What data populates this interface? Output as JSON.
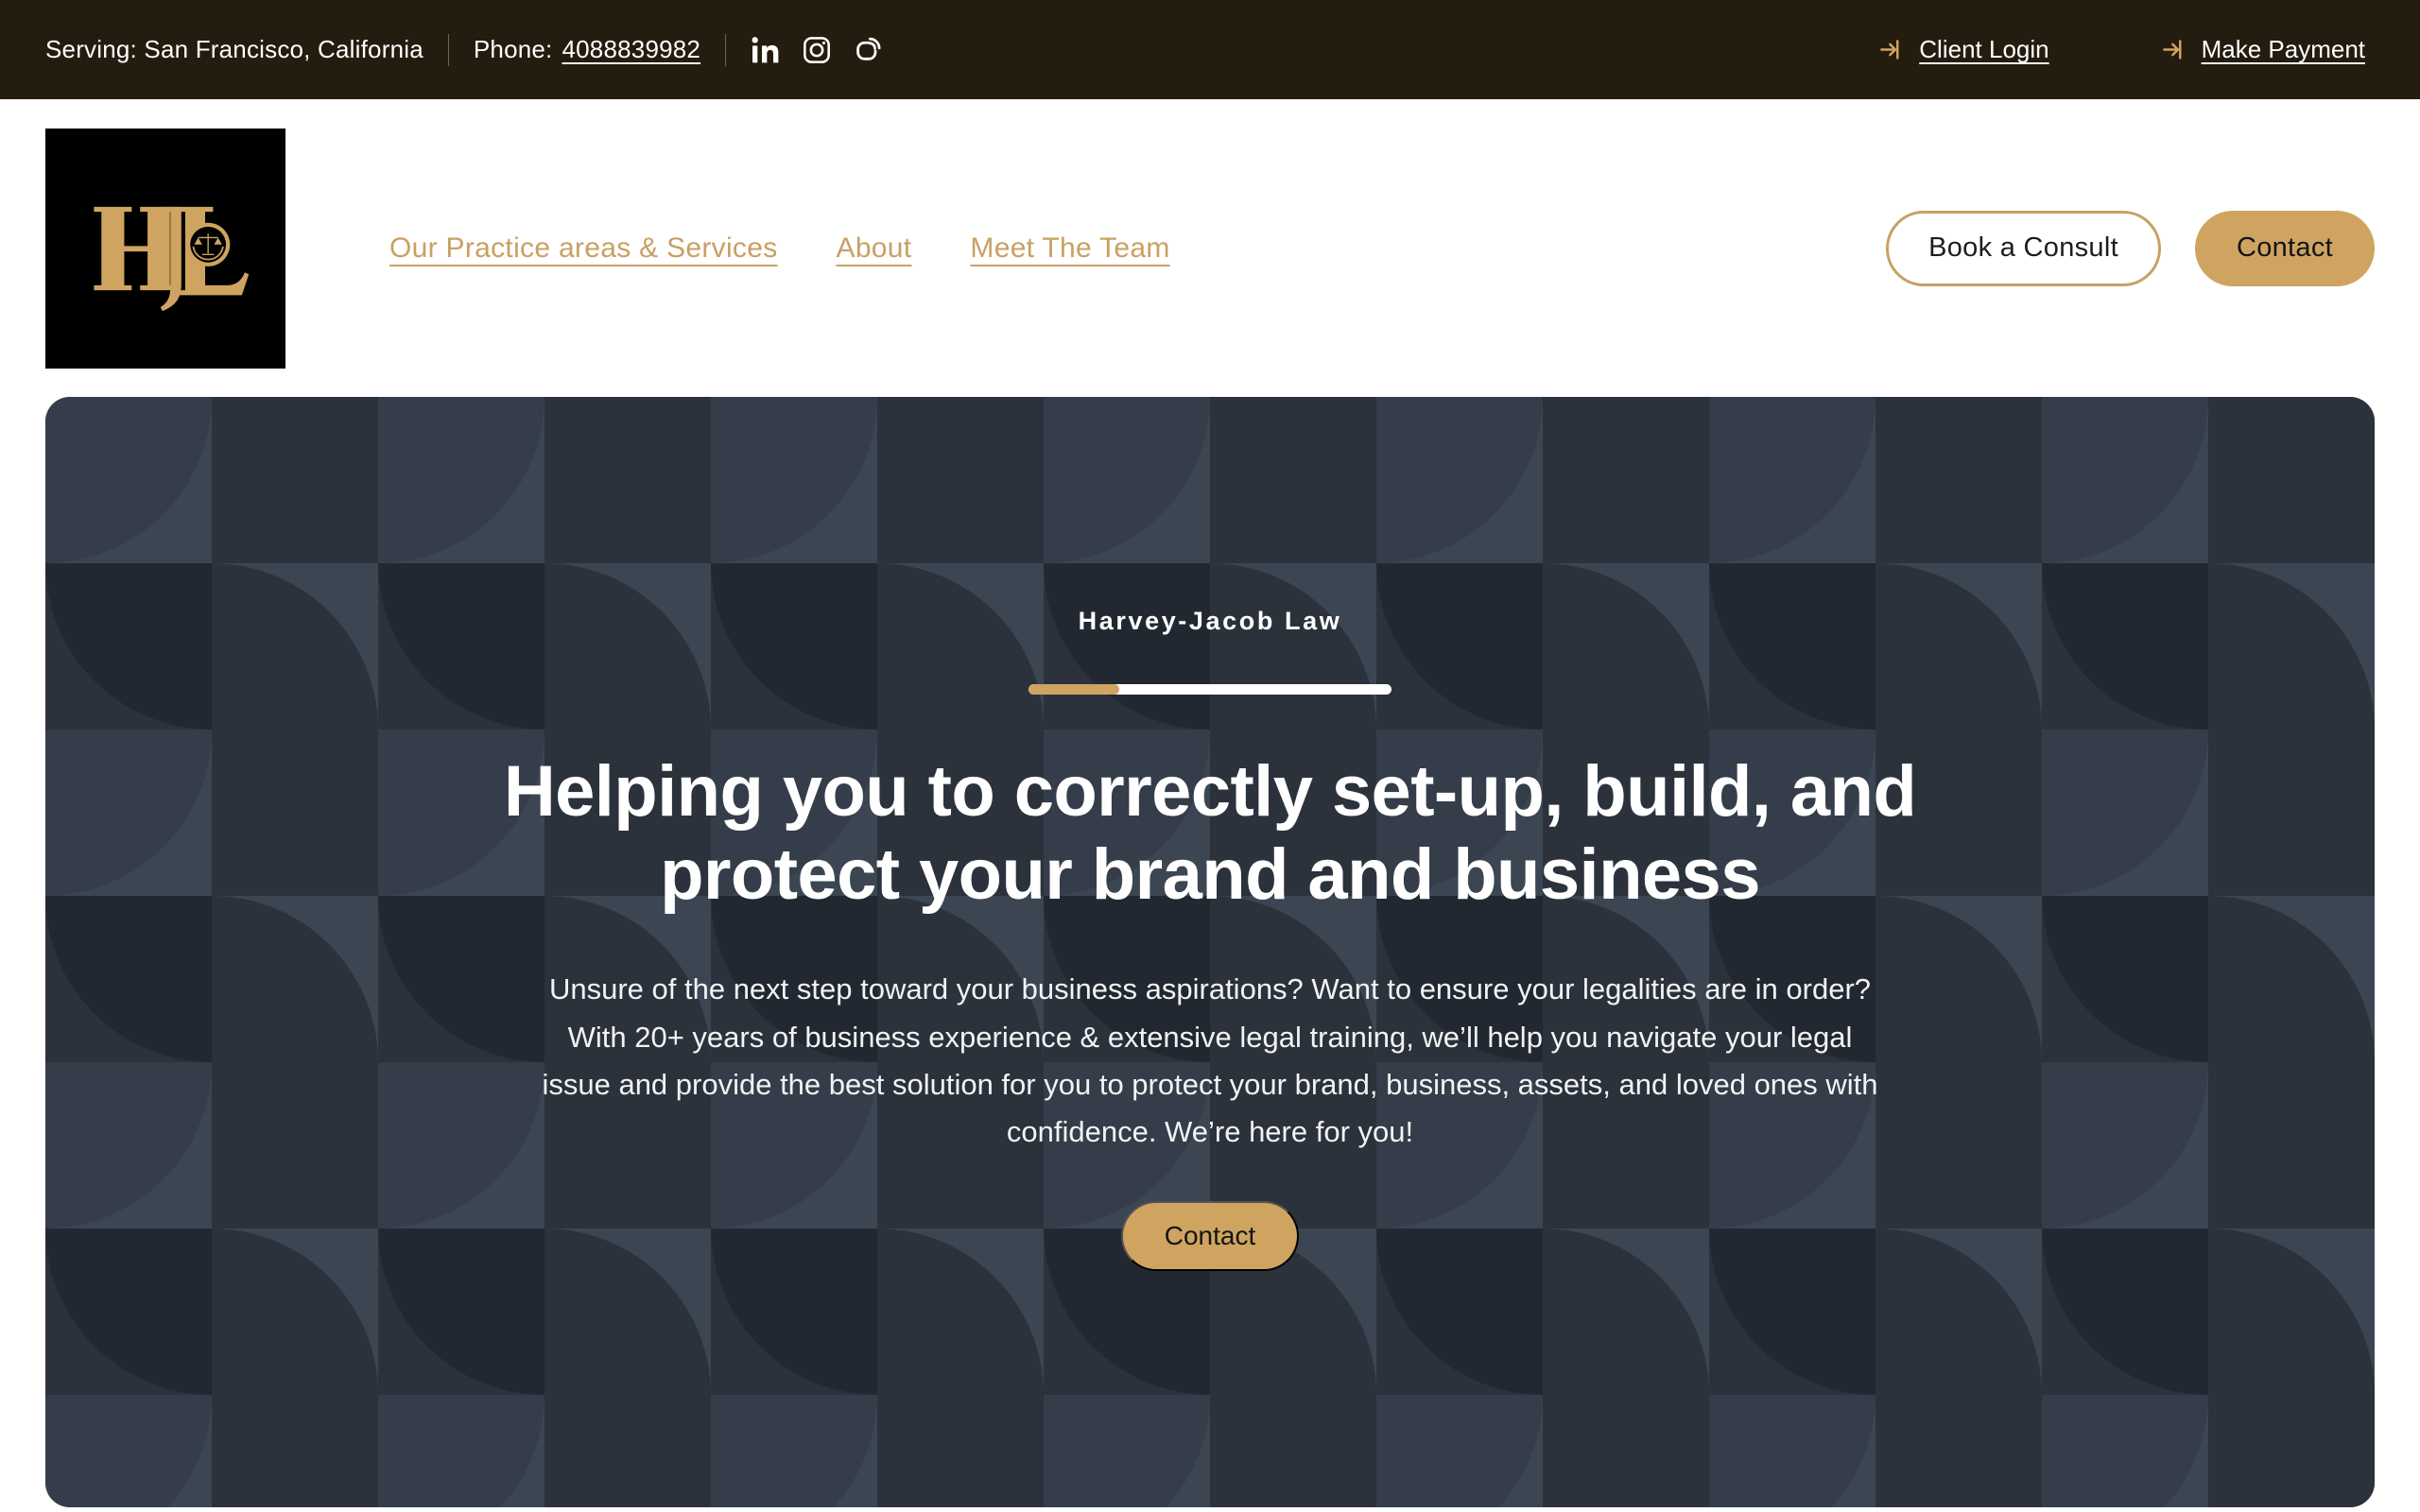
{
  "topbar": {
    "serving": "Serving: San Francisco, California",
    "phone_label": "Phone:",
    "phone_number": "4088839982",
    "socials": [
      {
        "name": "linkedin-icon"
      },
      {
        "name": "instagram-icon"
      },
      {
        "name": "blogger-icon"
      }
    ],
    "client_login": "Client Login",
    "make_payment": "Make Payment",
    "bg_color": "#241C0E"
  },
  "header": {
    "logo_alt": "HJL",
    "nav": [
      {
        "label": "Our Practice areas & Services"
      },
      {
        "label": "About"
      },
      {
        "label": "Meet The Team"
      }
    ],
    "book_consult": "Book a Consult",
    "contact": "Contact",
    "accent_color": "#CFA461"
  },
  "hero": {
    "eyebrow": "Harvey-Jacob Law",
    "progress_percent": 25,
    "title": "Helping you to correctly set-up, build, and protect your brand and business",
    "description": "Unsure of the next step toward your business aspirations? Want to ensure your legalities are in order? With 20+ years of business experience & extensive legal training, we’ll help you navigate your legal issue and provide the best solution for you to protect your brand, business, assets, and loved ones with confidence. We’re here for you!",
    "cta": "Contact",
    "bg_base_color": "#3C4653",
    "bg_dark_color": "#2B323C"
  }
}
